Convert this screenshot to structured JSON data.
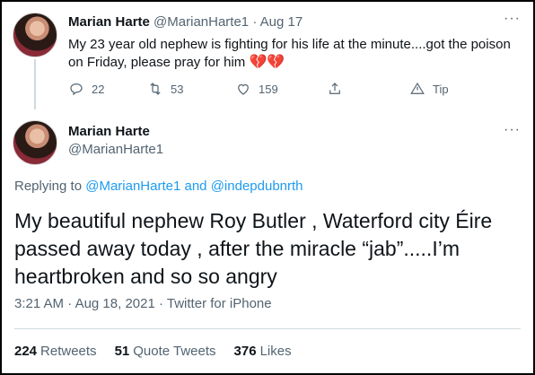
{
  "tweet1": {
    "name": "Marian Harte",
    "handle": "@MarianHarte1",
    "separator": "·",
    "date": "Aug 17",
    "text": "My 23 year old nephew is fighting for his life at the minute....got the poison on Friday, please pray for him",
    "emoji": "💔💔",
    "actions": {
      "reply_count": "22",
      "retweet_count": "53",
      "like_count": "159",
      "tip_label": "Tip"
    }
  },
  "tweet2": {
    "name": "Marian Harte",
    "handle": "@MarianHarte1",
    "replying_prefix": "Replying to",
    "replying_user1": "@MarianHarte1",
    "replying_and": "and",
    "replying_user2": "@indepdubnrth",
    "text": "My beautiful nephew Roy Butler , Waterford city Éire passed away today , after the miracle “jab”.....I’m heartbroken and so so angry",
    "time": "3:21 AM",
    "dot1": "·",
    "date": "Aug 18, 2021",
    "dot2": "·",
    "client": "Twitter for iPhone",
    "stats": {
      "retweets_count": "224",
      "retweets_label": "Retweets",
      "quotes_count": "51",
      "quotes_label": "Quote Tweets",
      "likes_count": "376",
      "likes_label": "Likes"
    }
  },
  "more_glyph": "···",
  "colors": {
    "link": "#1d9bf0",
    "muted": "#536471",
    "heart": "#d81b3f"
  }
}
